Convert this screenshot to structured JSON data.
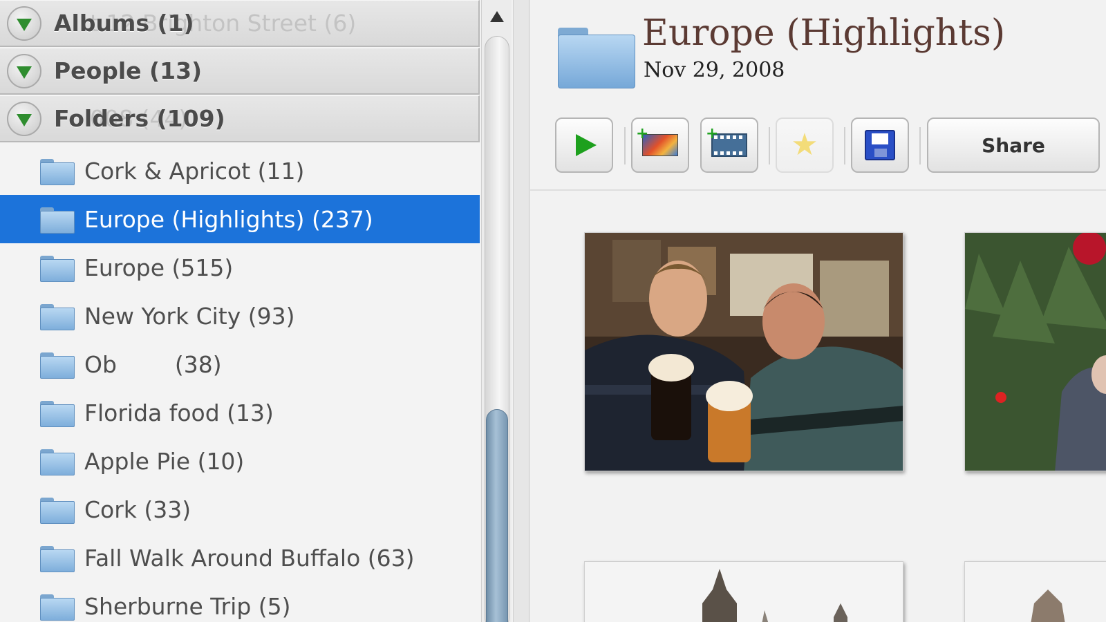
{
  "sidebar": {
    "sections": [
      {
        "label": "Albums (1)",
        "ghost": "t 12 Brighton Street (6)"
      },
      {
        "label": "People (13)",
        "ghost": ""
      },
      {
        "label": "Folders (109)",
        "ghost": "008 (44)"
      }
    ],
    "folders": [
      {
        "label": "Cork & Apricot (11)",
        "selected": false
      },
      {
        "label": "Europe (Highlights) (237)",
        "selected": true
      },
      {
        "label": "Europe (515)",
        "selected": false
      },
      {
        "label": "New York City (93)",
        "selected": false
      },
      {
        "label": "Ob        (38)",
        "selected": false
      },
      {
        "label": "Florida food (13)",
        "selected": false
      },
      {
        "label": "Apple Pie (10)",
        "selected": false
      },
      {
        "label": "Cork (33)",
        "selected": false
      },
      {
        "label": "Fall Walk Around Buffalo (63)",
        "selected": false
      },
      {
        "label": "Sherburne Trip (5)",
        "selected": false
      }
    ]
  },
  "main": {
    "title": "Europe (Highlights)",
    "date": "Nov 29, 2008",
    "toolbar": {
      "play_icon": "play-icon",
      "add_photo_icon": "add-to-collage-icon",
      "add_movie_icon": "add-to-movie-icon",
      "star_icon": "star-icon",
      "save_icon": "floppy-disk-icon",
      "share_label": "Share"
    }
  },
  "colors": {
    "selection": "#1c73da",
    "title": "#5b3a33",
    "play": "#1da01d",
    "disclosure": "#2f8d2f"
  }
}
